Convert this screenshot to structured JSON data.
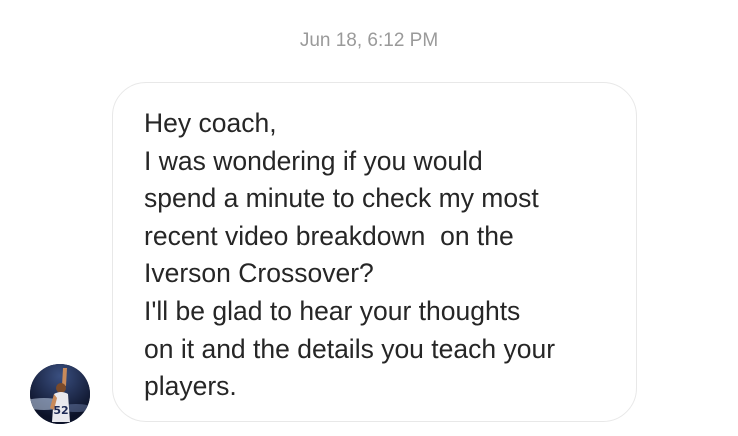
{
  "conversation": {
    "timestamp": "Jun 18, 6:12 PM",
    "message": {
      "text": "Hey coach,\nI was wondering if you would\nspend a minute to check my most\nrecent video breakdown  on the\nIverson Crossover?\nI'll be glad to hear your thoughts\non it and the details you teach your\nplayers."
    },
    "avatar": {
      "jersey_number": "52",
      "colors": {
        "background": "#0e1630",
        "court_light": "#c9d8f0",
        "skin": "#c98a5a",
        "jersey": "#e9e9ee"
      }
    }
  }
}
